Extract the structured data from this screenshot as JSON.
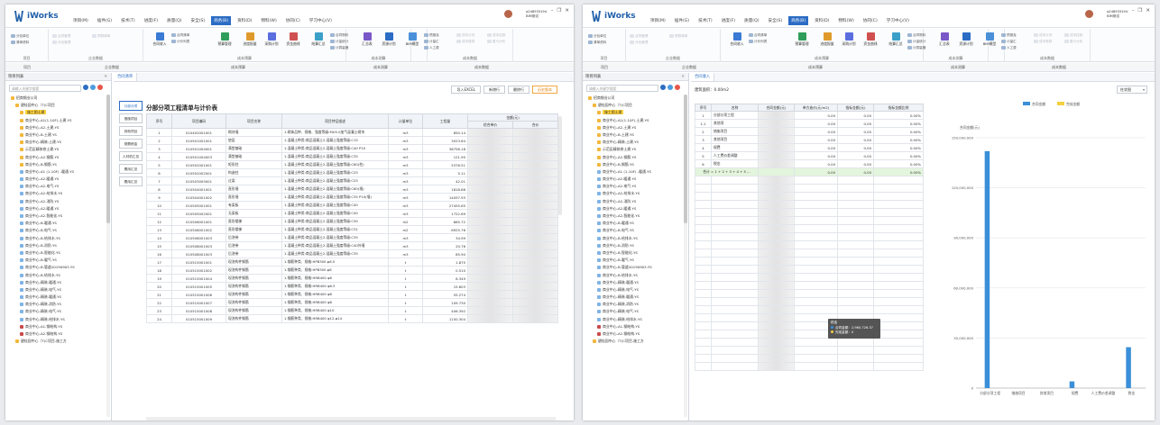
{
  "app": {
    "name": "iWorks",
    "user_id": "q248933194",
    "user_role": "BIM测试"
  },
  "menu": [
    "项目(M)",
    "插件(G)",
    "技术(T)",
    "进度(F)",
    "质量(Q)",
    "安全(S)",
    "商务(B)",
    "资料(D)",
    "物料(W)",
    "协同(C)",
    "学习中心(V)"
  ],
  "menu_active": "商务(B)",
  "ribbon": {
    "groups": [
      "项目",
      "企业数据",
      "成本预算",
      "成本测算",
      "项目招标",
      "成本管理",
      "成本数据"
    ],
    "project": [
      "分包单位",
      "清单资料"
    ],
    "enterprise": [
      "合同管理",
      "分包管理",
      "预算清单"
    ],
    "budget_big": [
      "合同收入",
      "预算管理",
      "进度报量",
      "采购计划",
      "资金曲线",
      "结算汇总",
      "汇总表",
      "资源计划",
      "BIM模型"
    ],
    "budget_small": [
      "合同清单",
      "计价列表",
      "合同物料",
      "计量统计",
      "计算量器",
      "预报及",
      "计量汇",
      "人工费"
    ],
    "cost_small": [
      "成本计划",
      "成本核算",
      "成本控制",
      "盈亏分析"
    ]
  },
  "colors": {
    "accent": "#2b6cc4",
    "highlight": "#ffd33a",
    "bar": "#3a8fd8",
    "bar2": "#f4d03f"
  },
  "left_panel": {
    "title": "项目列表",
    "search_placeholder": "请输入关键字搜索",
    "tree": [
      {
        "label": "招商钢业公司",
        "level": 0,
        "icon": "folder"
      },
      {
        "label": "碧桂园中心（T)C项目",
        "level": 1,
        "icon": "folder"
      },
      {
        "label": "施工图土建",
        "level": 2,
        "icon": "folder",
        "selected": true
      },
      {
        "label": "商业中心-A1(1-10F)-土建.YS",
        "level": 2,
        "icon": "file"
      },
      {
        "label": "商业中心-A2-土建.YS",
        "level": 2,
        "icon": "file"
      },
      {
        "label": "商业中心-B-土建.YS",
        "level": 2,
        "icon": "file"
      },
      {
        "label": "商业中心-精装-土建.YS",
        "level": 2,
        "icon": "file"
      },
      {
        "label": "示范区精装修土建.YS",
        "level": 2,
        "icon": "file"
      },
      {
        "label": "商业中心-A2-钢筋.YS",
        "level": 2,
        "icon": "file"
      },
      {
        "label": "商业中心-B-钢筋.YS",
        "level": 2,
        "icon": "file"
      },
      {
        "label": "商业中心-A1 (1-10F) -暖通.YS",
        "level": 2,
        "icon": "doc"
      },
      {
        "label": "商业中心-A2-暖通.YS",
        "level": 2,
        "icon": "doc"
      },
      {
        "label": "商业中心-A2-电气.YS",
        "level": 2,
        "icon": "doc"
      },
      {
        "label": "商业中心-A2-给排水.YS",
        "level": 2,
        "icon": "doc"
      },
      {
        "label": "商业中心-A2-消防.YS",
        "level": 2,
        "icon": "doc"
      },
      {
        "label": "商业中心-A2-暖通.YS",
        "level": 2,
        "icon": "doc"
      },
      {
        "label": "商业中心-A2-智能化.YS",
        "level": 2,
        "icon": "doc"
      },
      {
        "label": "商业中心-B-暖通.YS",
        "level": 2,
        "icon": "doc"
      },
      {
        "label": "商业中心-B-电气.YS",
        "level": 2,
        "icon": "doc"
      },
      {
        "label": "商业中心-B-给排水.YS",
        "level": 2,
        "icon": "doc"
      },
      {
        "label": "商业中心-B-消防.YS",
        "level": 2,
        "icon": "doc"
      },
      {
        "label": "商业中心-B-智能化.YS",
        "level": 2,
        "icon": "doc"
      },
      {
        "label": "商业中心-B-暖气.YS",
        "level": 2,
        "icon": "doc"
      },
      {
        "label": "商业中心-B-管道20190903.YS",
        "level": 2,
        "icon": "doc"
      },
      {
        "label": "商业中心-B-给排水.YS",
        "level": 2,
        "icon": "doc"
      },
      {
        "label": "商业中心-精装-暖通.YS",
        "level": 2,
        "icon": "doc"
      },
      {
        "label": "商业中心-精装-电气.YS",
        "level": 2,
        "icon": "doc"
      },
      {
        "label": "商业中心-精装-暖通.YS",
        "level": 2,
        "icon": "doc"
      },
      {
        "label": "商业中心-精装-消防.YS",
        "level": 2,
        "icon": "doc"
      },
      {
        "label": "商业中心-精装-电气.YS",
        "level": 2,
        "icon": "doc"
      },
      {
        "label": "商业中心-精装-给排水.YS",
        "level": 2,
        "icon": "doc"
      },
      {
        "label": "商业中心-A1-钢结构.YS",
        "level": 2,
        "icon": "red"
      },
      {
        "label": "商业中心-A2-钢结构.YS",
        "level": 2,
        "icon": "red"
      },
      {
        "label": "碧桂园中心（T)C项目-施工方",
        "level": 1,
        "icon": "folder"
      }
    ]
  },
  "window1": {
    "tab": "合同清单",
    "actions": [
      "导入EXCEL",
      "新增行",
      "删除行",
      "历史版本"
    ],
    "side_buttons": [
      "分部分项",
      "措施项目",
      "其他项目",
      "规费税金",
      "人材机汇总",
      "费用汇总",
      "费用汇总"
    ],
    "title": "分部分项工程清单与计价表",
    "headers": [
      "序号",
      "项目编码",
      "项目名称",
      "项目特征描述",
      "计量单位",
      "工程量",
      "金额(元)",
      "综合单价",
      "合价"
    ],
    "rows": [
      [
        "1",
        "010402001001",
        "砌块墙",
        "1.砌体品种、规格、强度等级:MU5.0加气混凝土砌块",
        "m3",
        "850.14"
      ],
      [
        "2",
        "010501001001",
        "垫层",
        "1.混凝土种类:商品混凝土2.混凝土强度等级:C15",
        "m3",
        "3023.64"
      ],
      [
        "3",
        "010501004001",
        "满堂基础",
        "1.混凝土种类:商品混凝土2.混凝土强度等级:C40 P10",
        "m3",
        "38756.18"
      ],
      [
        "4",
        "010501004003",
        "满堂基础",
        "1.混凝土种类:商品混凝土2.混凝土强度等级:C35",
        "m3",
        "121.95"
      ],
      [
        "5",
        "010502001001",
        "矩形柱",
        "1.混凝土种类:商品混凝土2.混凝土强度等级:C60(柱)",
        "m3",
        "5376.51"
      ],
      [
        "6",
        "010502002001",
        "构造柱",
        "1.混凝土种类:商品混凝土2.混凝土强度等级:C25",
        "m3",
        "5.11"
      ],
      [
        "7",
        "010503005001",
        "过梁",
        "1.混凝土种类:商品混凝土2.混凝土强度等级:C25",
        "m3",
        "42.01"
      ],
      [
        "8",
        "010504001001",
        "直形墙",
        "1.混凝土种类:商品混凝土2.混凝土强度等级:C60(墙)",
        "m3",
        "1818.86"
      ],
      [
        "9",
        "010504001002",
        "直形墙",
        "1.混凝土种类:商品混凝土2.混凝土强度等级:C35 P10(墙)",
        "m3",
        "14057.93"
      ],
      [
        "10",
        "010505001001",
        "有梁板",
        "1.混凝土种类:商品混凝土2.混凝土强度等级:C40",
        "m3",
        "27455.65"
      ],
      [
        "11",
        "010505002001",
        "无梁板",
        "1.混凝土种类:商品混凝土2.混凝土强度等级:C40",
        "m3",
        "1722.69"
      ],
      [
        "12",
        "010506001001",
        "直形楼梯",
        "1.混凝土种类:商品混凝土2.混凝土强度等级:C30",
        "m2",
        "865.72"
      ],
      [
        "13",
        "010508001002",
        "直形楼梯",
        "1.混凝土种类:商品混凝土2.混凝土强度等级:C31",
        "m2",
        "6925.76"
      ],
      [
        "14",
        "010508001003",
        "后浇带",
        "1.混凝土种类:商品混凝土2.混凝土强度等级:C35",
        "m3",
        "34.99"
      ],
      [
        "15",
        "010508001003",
        "后浇带",
        "1.混凝土种类:商品混凝土2.混凝土强度等级:C40外墙",
        "m3",
        "20.76"
      ],
      [
        "16",
        "010508001003",
        "后浇带",
        "1.混凝土种类:商品混凝土2.混凝土强度等级:C35",
        "m3",
        "85.90"
      ],
      [
        "17",
        "010515001001",
        "现浇构件钢筋",
        "1.钢筋种类、规格:HPB300 φ6.5",
        "t",
        "1.875"
      ],
      [
        "18",
        "010515001002",
        "现浇构件钢筋",
        "1.钢筋种类、规格:HPB300 φ8",
        "t",
        "0.510"
      ],
      [
        "19",
        "010515001004",
        "现浇构件钢筋",
        "1.钢筋种类、规格:HRB400 φ6",
        "t",
        "8.349"
      ],
      [
        "20",
        "010515001005",
        "现浇构件钢筋",
        "1.钢筋种类、规格:HRB400 φ6.5",
        "t",
        "15.603"
      ],
      [
        "21",
        "010515001006",
        "现浇构件钢筋",
        "1.钢筋种类、规格:HRB400 φ8",
        "t",
        "55.274"
      ],
      [
        "22",
        "010515001007",
        "现浇构件钢筋",
        "1.钢筋种类、规格:HRB400 φ8",
        "t",
        "109.730"
      ],
      [
        "23",
        "010515001008",
        "现浇构件钢筋",
        "1.钢筋种类、规格:HRB400 φ10",
        "t",
        "406.392"
      ],
      [
        "24",
        "010515001009",
        "现浇构件钢筋",
        "1.钢筋种类、规格:HRB400 φ12-φ14",
        "t",
        "1150.304"
      ]
    ]
  },
  "window2": {
    "tab": "合同收入",
    "area_label": "建筑面积：0.00m2",
    "chart_select": "柱状图",
    "headers": [
      "序号",
      "名称",
      "合同金额(元)",
      "单方造价(元/m2)",
      "指标金额(元)",
      "指标金额比例"
    ],
    "rows": [
      [
        "1",
        "分部分项工程",
        "",
        "0.00",
        "0.00",
        "0.00%"
      ],
      [
        "1.1",
        "其他项",
        "",
        "0.00",
        "0.00",
        "0.00%"
      ],
      [
        "2",
        "措施项目",
        "",
        "0.00",
        "0.00",
        "0.00%"
      ],
      [
        "3",
        "其他项目",
        "",
        "0.00",
        "0.00",
        "0.00%"
      ],
      [
        "4",
        "规费",
        "",
        "0.00",
        "0.00",
        "0.00%"
      ],
      [
        "5",
        "人工费价差调整",
        "",
        "0.00",
        "0.00",
        "0.00%"
      ],
      [
        "6",
        "税金",
        "",
        "0.00",
        "0.00",
        "0.00%"
      ],
      [
        "合计 = 1 + 2 + 3 + 4 + 5 ...",
        "",
        "",
        "0.00",
        "0.00",
        "0.00%"
      ]
    ],
    "tooltip": {
      "title": "税金",
      "line1": "合同金额：2,960,726.37",
      "line2": "完成金额：0"
    }
  },
  "chart_data": {
    "type": "bar",
    "categories": [
      "分部分项工程",
      "措施项目",
      "其他项目",
      "规费",
      "人工费价差调整",
      "税金"
    ],
    "series": [
      {
        "name": "合同金额",
        "values": [
          142000000,
          0,
          0,
          4000000,
          0,
          24500000
        ]
      },
      {
        "name": "完成金额",
        "values": [
          0,
          0,
          0,
          0,
          0,
          0
        ]
      }
    ],
    "ylabel": "合同金额(元)",
    "yticks": [
      "0",
      "30,000,000",
      "60,000,000",
      "90,000,000",
      "120,000,000",
      "150,000,000"
    ],
    "ylim": [
      0,
      150000000
    ],
    "legend": "top"
  }
}
